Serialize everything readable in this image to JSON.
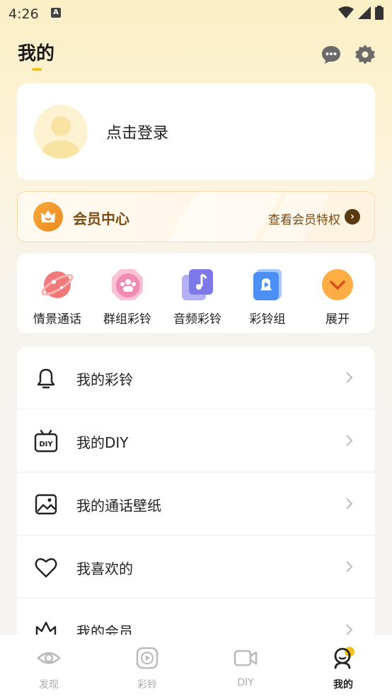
{
  "status_bar": {
    "time": "4:26",
    "notif_letter": "A"
  },
  "header": {
    "title": "我的",
    "message_icon": "chat-bubble-icon",
    "settings_icon": "gear-icon"
  },
  "login": {
    "text": "点击登录",
    "avatar_icon": "default-avatar-icon"
  },
  "vip": {
    "title": "会员中心",
    "link": "查看会员特权",
    "arrow": "›"
  },
  "quick_actions": [
    {
      "label": "情景通话",
      "icon": "planet-icon"
    },
    {
      "label": "群组彩铃",
      "icon": "group-icon"
    },
    {
      "label": "音频彩铃",
      "icon": "music-note-icon"
    },
    {
      "label": "彩铃组",
      "icon": "bell-folder-icon"
    },
    {
      "label": "展开",
      "icon": "expand-chevron-icon"
    }
  ],
  "menu": [
    {
      "label": "我的彩铃",
      "icon": "bell-icon"
    },
    {
      "label": "我的DIY",
      "icon": "diy-tv-icon",
      "badge": "DIY"
    },
    {
      "label": "我的通话壁纸",
      "icon": "wallpaper-icon"
    },
    {
      "label": "我喜欢的",
      "icon": "heart-icon"
    },
    {
      "label": "我的会员",
      "icon": "crown-icon"
    }
  ],
  "tabs": [
    {
      "label": "发现",
      "icon": "eye-icon",
      "active": false
    },
    {
      "label": "彩铃",
      "icon": "play-icon",
      "active": false
    },
    {
      "label": "DIY",
      "icon": "video-camera-icon",
      "active": false
    },
    {
      "label": "我的",
      "icon": "profile-icon",
      "active": true
    }
  ],
  "colors": {
    "accent": "#f6c21a",
    "vip_brown": "#7a4a13",
    "vip_orange": "#eb8a21"
  }
}
